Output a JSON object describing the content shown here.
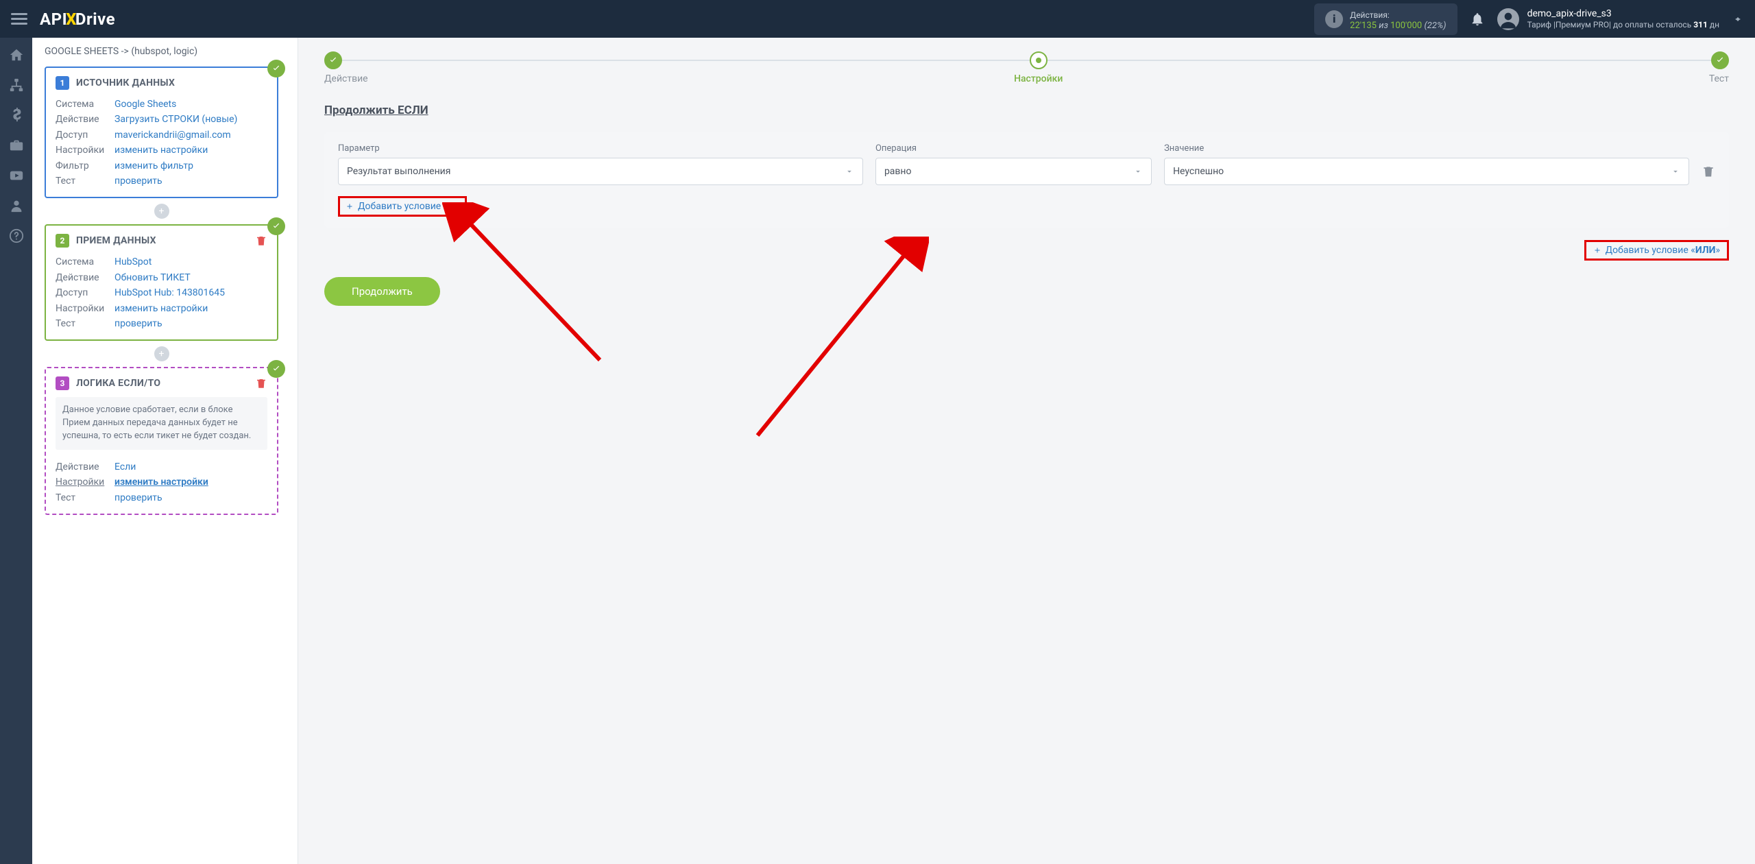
{
  "logo": {
    "p1": "API",
    "p2": "X",
    "p3": "Drive"
  },
  "header": {
    "actions_label": "Действия:",
    "actions_used": "22'135",
    "actions_of": "из",
    "actions_total": "100'000",
    "actions_pct": "(22%)",
    "user": "demo_apix-drive_s3",
    "tariff_prefix": "Тариф |Премиум PRO| до оплаты осталось ",
    "tariff_days": "311",
    "tariff_suffix": " дн"
  },
  "breadcrumb": "GOOGLE SHEETS -> (hubspot, logic)",
  "card1": {
    "num": "1",
    "title": "ИСТОЧНИК ДАННЫХ",
    "rows": [
      {
        "label": "Система",
        "value": "Google Sheets"
      },
      {
        "label": "Действие",
        "value": "Загрузить СТРОКИ (новые)"
      },
      {
        "label": "Доступ",
        "value": "maverickandrii@gmail.com"
      },
      {
        "label": "Настройки",
        "value": "изменить настройки"
      },
      {
        "label": "Фильтр",
        "value": "изменить фильтр"
      },
      {
        "label": "Тест",
        "value": "проверить"
      }
    ]
  },
  "card2": {
    "num": "2",
    "title": "ПРИЕМ ДАННЫХ",
    "rows": [
      {
        "label": "Система",
        "value": "HubSpot"
      },
      {
        "label": "Действие",
        "value": "Обновить ТИКЕТ"
      },
      {
        "label": "Доступ",
        "value": "HubSpot Hub: 143801645"
      },
      {
        "label": "Настройки",
        "value": "изменить настройки"
      },
      {
        "label": "Тест",
        "value": "проверить"
      }
    ]
  },
  "card3": {
    "num": "3",
    "title": "ЛОГИКА ЕСЛИ/ТО",
    "info": "Данное условие сработает, если в блоке Прием данных передача данных будет не успешна, то есть если тикет не будет создан.",
    "rows": [
      {
        "label": "Действие",
        "value": "Если"
      },
      {
        "label": "Настройки",
        "value": "изменить настройки",
        "u": true
      },
      {
        "label": "Тест",
        "value": "проверить"
      }
    ]
  },
  "steps": {
    "s1": "Действие",
    "s2": "Настройки",
    "s3": "Тест"
  },
  "main": {
    "title": "Продолжить ЕСЛИ",
    "param_label": "Параметр",
    "param_value": "Результат выполнения",
    "op_label": "Операция",
    "op_value": "равно",
    "val_label": "Значение",
    "val_value": "Неуспешно",
    "add_and": "Добавить условие «И»",
    "add_or_prefix": "Добавить условие «",
    "add_or_bold": "ИЛИ",
    "add_or_suffix": "»",
    "continue": "Продолжить"
  }
}
